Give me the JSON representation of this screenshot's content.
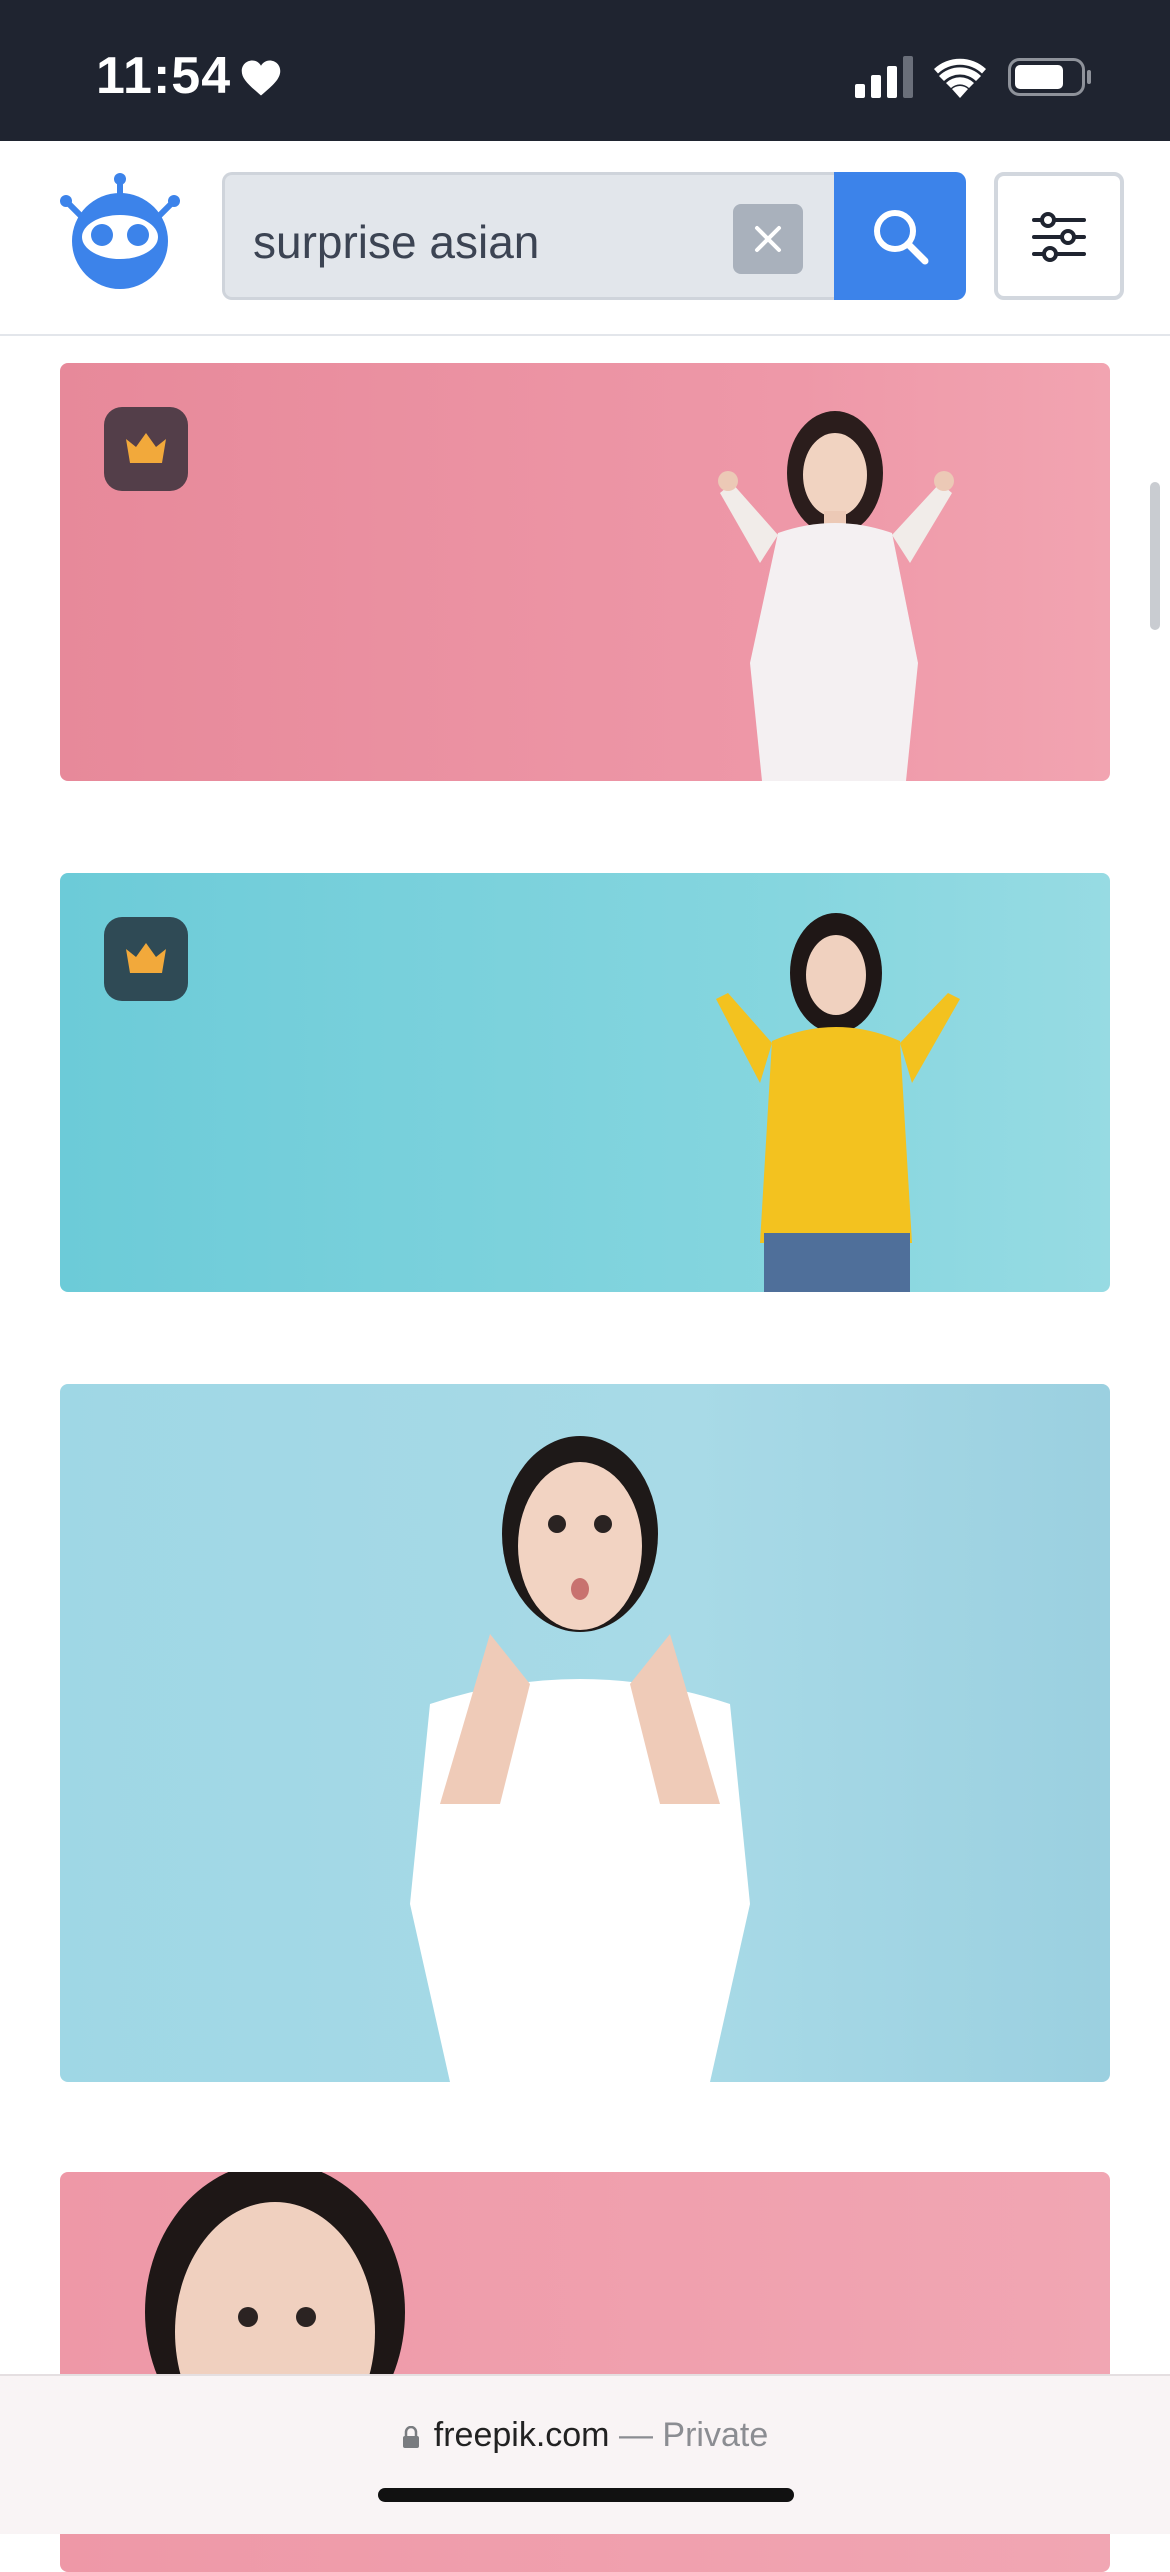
{
  "status_bar": {
    "time": "11:54",
    "icons": [
      "heart-icon",
      "cellular-signal-icon",
      "wifi-icon",
      "battery-icon"
    ]
  },
  "header": {
    "logo": "freepik-robot-logo",
    "search": {
      "value": "surprise asian",
      "placeholder": ""
    },
    "buttons": [
      "clear-search",
      "search",
      "filters"
    ]
  },
  "colors": {
    "accent": "#3c83ea",
    "status_bar_bg": "#1f2430",
    "premium_crown": "#f2a93b"
  },
  "results": [
    {
      "id": "result-1",
      "premium": true,
      "background": "#ee98a8"
    },
    {
      "id": "result-2",
      "premium": true,
      "background": "#86d6df"
    },
    {
      "id": "result-3",
      "premium": false,
      "background": "#a8dae7"
    },
    {
      "id": "result-4",
      "premium": false,
      "background": "#f1a6b3"
    }
  ],
  "browser": {
    "domain": "freepik.com",
    "separator": " — ",
    "mode": "Private"
  }
}
